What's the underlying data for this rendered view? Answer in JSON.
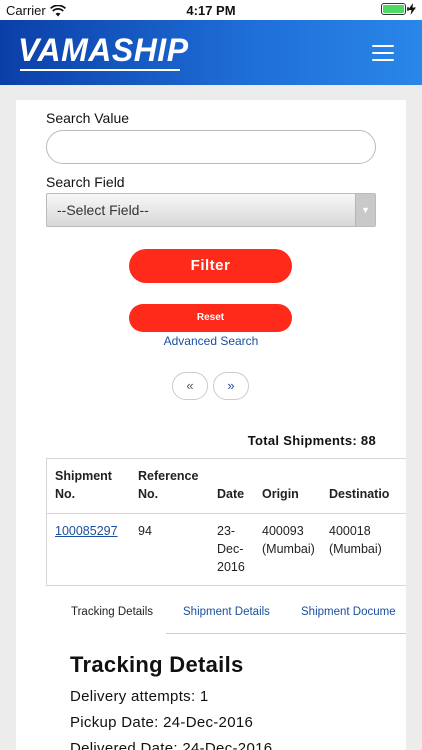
{
  "status_bar": {
    "carrier": "Carrier",
    "time": "4:17 PM"
  },
  "header": {
    "logo": "VAMASHIP",
    "menu_icon": "hamburger-icon"
  },
  "form": {
    "search_value_label": "Search Value",
    "search_value": "",
    "search_field_label": "Search Field",
    "search_field_selected": "--Select Field--",
    "filter_label": "Filter",
    "reset_label": "Reset",
    "advanced_search_label": "Advanced Search"
  },
  "pagination": {
    "prev": "«",
    "next": "»"
  },
  "total_shipments": "Total Shipments: 88",
  "table": {
    "headers": [
      "Shipment\nNo.",
      "Reference\nNo.",
      "Date",
      "Origin",
      "Destinatio"
    ],
    "rows": [
      {
        "shipment_no": "100085297",
        "reference_no": "94",
        "date": "23-\nDec-\n2016",
        "origin": "400093\n(Mumbai)",
        "destination": "400018\n(Mumbai)"
      }
    ]
  },
  "tabs": [
    {
      "label": "Tracking Details",
      "active": true
    },
    {
      "label": "Shipment Details",
      "active": false
    },
    {
      "label": "Shipment Docume",
      "active": false
    }
  ],
  "tracking": {
    "title": "Tracking Details",
    "delivery_attempts": "Delivery attempts: 1",
    "pickup_date": "Pickup Date: 24-Dec-2016",
    "delivered_date": "Delivered Date: 24-Dec-2016"
  },
  "colors": {
    "brand_blue": "#1f6fd8",
    "accent_red": "#ff2a1a",
    "link_blue": "#1a4fa0"
  }
}
